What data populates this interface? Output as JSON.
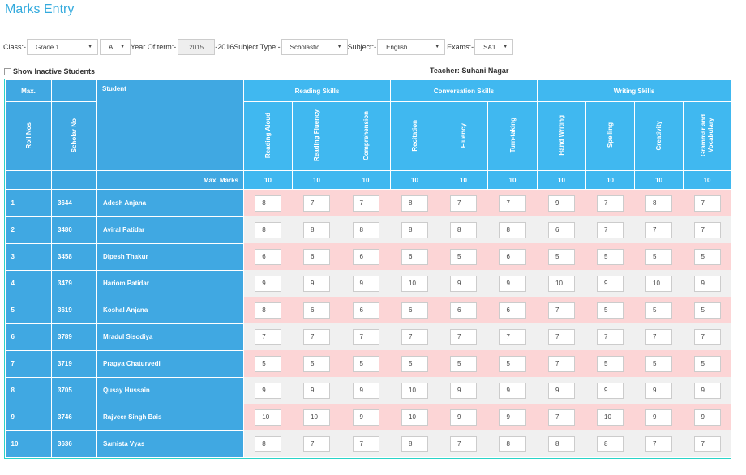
{
  "page": {
    "title": "Marks Entry"
  },
  "filters": {
    "class_label": "Class:-",
    "class_value": "Grade 1",
    "section_value": "A",
    "year_label": "Year Of term:-",
    "year_value": "2015",
    "year_end": "-2016",
    "subject_type_label": "Subject Type:-",
    "subject_type_value": "Scholastic",
    "subject_label": "Subject:-",
    "subject_value": "English",
    "exams_label": "Exams:-",
    "exams_value": "SA1"
  },
  "show_inactive_label": "Show Inactive Students",
  "teacher_label": "Teacher: Suhani Nagar",
  "table": {
    "max_label": "Max.",
    "student_header": "Student",
    "roll_header": "Roll Nos",
    "scholar_header": "Scholar No",
    "max_marks_label": "Max. Marks",
    "groups": [
      "Reading Skills",
      "Conversation Skills",
      "Writing Skills"
    ],
    "columns": [
      "Reading Aloud",
      "Reading Fluency",
      "Comprehension",
      "Recitation",
      "Fluency",
      "Turn-taking",
      "Hand Writing",
      "Spelling",
      "Creativity",
      "Grammar and Vocabulary"
    ],
    "max_marks": [
      "10",
      "10",
      "10",
      "10",
      "10",
      "10",
      "10",
      "10",
      "10",
      "10"
    ],
    "rows": [
      {
        "roll": "1",
        "scholar": "3644",
        "name": "Adesh Anjana",
        "marks": [
          "8",
          "7",
          "7",
          "8",
          "7",
          "7",
          "9",
          "7",
          "8",
          "7"
        ]
      },
      {
        "roll": "2",
        "scholar": "3480",
        "name": "Aviral Patidar",
        "marks": [
          "8",
          "8",
          "8",
          "8",
          "8",
          "8",
          "6",
          "7",
          "7",
          "7"
        ]
      },
      {
        "roll": "3",
        "scholar": "3458",
        "name": "Dipesh Thakur",
        "marks": [
          "6",
          "6",
          "6",
          "6",
          "5",
          "6",
          "5",
          "5",
          "5",
          "5"
        ]
      },
      {
        "roll": "4",
        "scholar": "3479",
        "name": "Hariom Patidar",
        "marks": [
          "9",
          "9",
          "9",
          "10",
          "9",
          "9",
          "10",
          "9",
          "10",
          "9"
        ]
      },
      {
        "roll": "5",
        "scholar": "3619",
        "name": "Koshal Anjana",
        "marks": [
          "8",
          "6",
          "6",
          "6",
          "6",
          "6",
          "7",
          "5",
          "5",
          "5"
        ]
      },
      {
        "roll": "6",
        "scholar": "3789",
        "name": "Mradul Sisodiya",
        "marks": [
          "7",
          "7",
          "7",
          "7",
          "7",
          "7",
          "7",
          "7",
          "7",
          "7"
        ]
      },
      {
        "roll": "7",
        "scholar": "3719",
        "name": "Pragya Chaturvedi",
        "marks": [
          "5",
          "5",
          "5",
          "5",
          "5",
          "5",
          "7",
          "5",
          "5",
          "5"
        ]
      },
      {
        "roll": "8",
        "scholar": "3705",
        "name": "Qusay Hussain",
        "marks": [
          "9",
          "9",
          "9",
          "10",
          "9",
          "9",
          "9",
          "9",
          "9",
          "9"
        ]
      },
      {
        "roll": "9",
        "scholar": "3746",
        "name": "Rajveer Singh Bais",
        "marks": [
          "10",
          "10",
          "9",
          "10",
          "9",
          "9",
          "7",
          "10",
          "9",
          "9"
        ]
      },
      {
        "roll": "10",
        "scholar": "3636",
        "name": "Samista Vyas",
        "marks": [
          "8",
          "7",
          "7",
          "8",
          "7",
          "8",
          "8",
          "8",
          "7",
          "7"
        ]
      }
    ]
  }
}
